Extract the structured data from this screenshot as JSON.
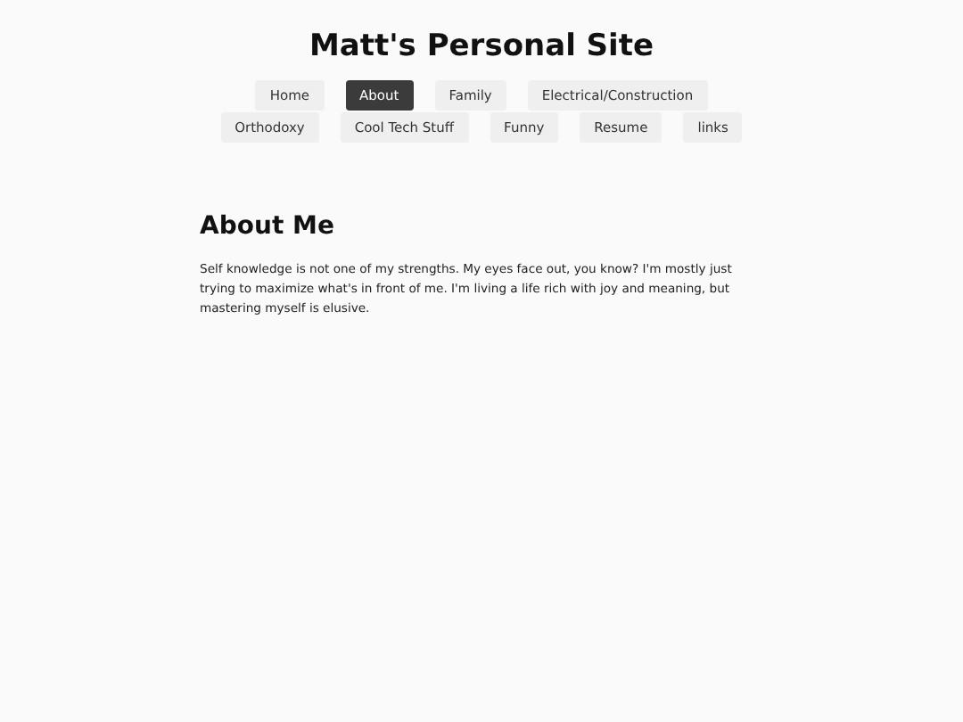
{
  "site_title": "Matt's Personal Site",
  "nav": [
    {
      "label": "Home",
      "selected": false
    },
    {
      "label": "About",
      "selected": true
    },
    {
      "label": "Family",
      "selected": false
    },
    {
      "label": "Electrical/Construction",
      "selected": false
    },
    {
      "label": "Orthodoxy",
      "selected": false
    },
    {
      "label": "Cool Tech Stuff",
      "selected": false
    },
    {
      "label": "Funny",
      "selected": false
    },
    {
      "label": "Resume",
      "selected": false
    },
    {
      "label": "links",
      "selected": false
    }
  ],
  "heading": "About Me",
  "paragraph": "Self knowledge is not one of my strengths. My eyes face out, you know? I'm mostly just trying to maximize what's in front of me. I'm living a life rich with joy and meaning, but mastering myself is elusive."
}
